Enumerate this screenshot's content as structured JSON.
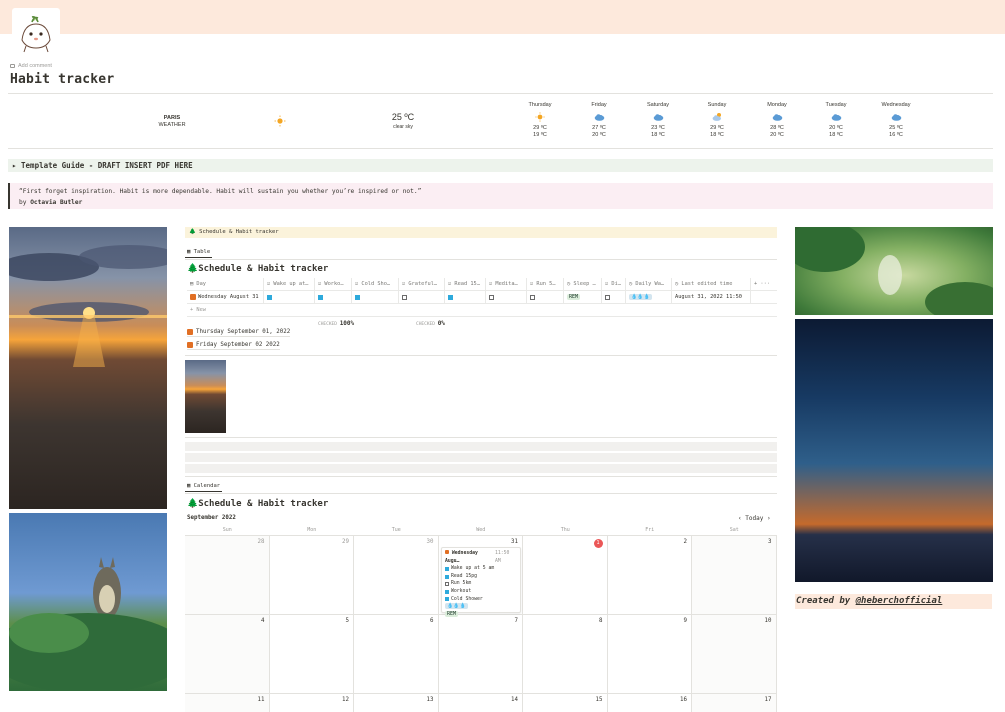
{
  "page": {
    "add_comment": "Add comment",
    "title": "Habit tracker",
    "icon": "sprout-creature-icon"
  },
  "weather": {
    "city": "PARIS",
    "city_sub": "WEATHER",
    "current_temp": "25 ºC",
    "current_desc": "clear sky",
    "days": [
      {
        "day": "Thursday",
        "icon": "sun-icon",
        "high": "29 ºC",
        "low": "19 ºC"
      },
      {
        "day": "Friday",
        "icon": "cloud-icon",
        "high": "27 ºC",
        "low": "20 ºC"
      },
      {
        "day": "Saturday",
        "icon": "cloud-icon",
        "high": "23 ºC",
        "low": "18 ºC"
      },
      {
        "day": "Sunday",
        "icon": "sun-cloud-icon",
        "high": "29 ºC",
        "low": "18 ºC"
      },
      {
        "day": "Monday",
        "icon": "cloud-icon",
        "high": "28 ºC",
        "low": "20 ºC"
      },
      {
        "day": "Tuesday",
        "icon": "cloud-icon",
        "high": "20 ºC",
        "low": "18 ºC"
      },
      {
        "day": "Wednesday",
        "icon": "cloud-icon",
        "high": "25 ºC",
        "low": "16 ºC"
      }
    ]
  },
  "toggle": "▸ Template Guide - DRAFT INSERT PDF HERE",
  "quote": {
    "text": "“First forget inspiration. Habit is more dependable. Habit will sustain you whether you’re inspired or not.”",
    "by": "by",
    "author": "Octavia Butler"
  },
  "db": {
    "crumb": "Schedule & Habit tracker",
    "table_tab": "Table",
    "title": "Schedule & Habit tracker",
    "columns": [
      "Day",
      "Wake up at…",
      "Worko…",
      "Cold Sho…",
      "Grateful…",
      "Read 15…",
      "Medita…",
      "Run 5…",
      "Sleep …",
      "Di…",
      "Daily Wa…",
      "Last edited time"
    ],
    "row": {
      "day": "Wednesday August 31",
      "sleep_tag": "REM",
      "water_tag": "💧💧💧",
      "last_edited": "August 31, 2022 11:50"
    },
    "new_label": "+ New",
    "calc_label_1": "CHECKED",
    "calc_value_1": "100%",
    "calc_label_2": "CHECKED",
    "calc_value_2": "0%",
    "sub_items": [
      "Thursday September 01, 2022",
      "Friday September 02 2022"
    ],
    "calendar_tab": "Calendar",
    "cal_title": "Schedule & Habit tracker",
    "month": "September 2022",
    "today_btn": "Today",
    "dows": [
      "Sun",
      "Mon",
      "Tue",
      "Wed",
      "Thu",
      "Fri",
      "Sat"
    ],
    "card": {
      "title": "Wednesday Augu…",
      "time": "11:50 AM",
      "items": [
        {
          "label": "Wake up at 5 am",
          "on": true
        },
        {
          "label": "Read 15pg",
          "on": true
        },
        {
          "label": "Run 5km",
          "on": false
        },
        {
          "label": "Workout",
          "on": true
        },
        {
          "label": "Cold Shower",
          "on": true
        }
      ],
      "water": "💧💧💧",
      "sleep": "REM"
    },
    "week1": [
      "28",
      "29",
      "30",
      "31",
      "1",
      "2",
      "3"
    ],
    "week2": [
      "4",
      "5",
      "6",
      "7",
      "8",
      "9",
      "10"
    ],
    "week3": [
      "11",
      "12",
      "13",
      "14",
      "15",
      "16",
      "17"
    ]
  },
  "credit": {
    "prefix": "Created by ",
    "handle": "@heberchofficial"
  }
}
